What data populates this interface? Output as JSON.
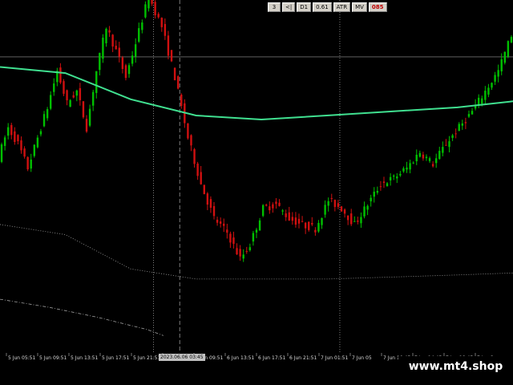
{
  "toolbar": {
    "buttons": [
      {
        "label": "3",
        "style": "normal"
      },
      {
        "label": "<|",
        "style": "normal"
      },
      {
        "label": "D1",
        "style": "normal"
      },
      {
        "label": "0.61",
        "style": "normal"
      },
      {
        "label": "ATR",
        "style": "normal"
      },
      {
        "label": "MV",
        "style": "normal"
      },
      {
        "label": "085",
        "style": "red"
      }
    ]
  },
  "time_axis": {
    "labels": [
      "5 Jun 05:51",
      "5 Jun 09:51",
      "5 Jun 13:51",
      "5 Jun 17:51",
      "5 Jun 21:51",
      "6 Jun 05:51",
      "6 Jun 09:51",
      "6 Jun 13:51",
      "6 Jun 17:51",
      "6 Jun 21:51",
      "7 Jun 01:51",
      "7 Jun 05",
      "7 Jun 10:45",
      "7 Jun 14:45",
      "7 Jun 18:45",
      "7 Jun 2"
    ]
  },
  "cursor_time_label": "2023.06.06 03:45",
  "watermark": "www.mt4.shop",
  "colors": {
    "bull": "#00c000",
    "bear": "#d01010",
    "ma": "#40e090",
    "grid": "#9a9a9a",
    "dotted": "#a0a0a0"
  },
  "chart_data": {
    "type": "candlestick",
    "title": "",
    "xlabel": "",
    "ylabel": "",
    "price_path": [
      [
        0,
        85
      ],
      [
        3,
        100
      ],
      [
        6,
        92
      ],
      [
        9,
        80
      ],
      [
        12,
        95
      ],
      [
        15,
        110
      ],
      [
        18,
        128
      ],
      [
        21,
        112
      ],
      [
        24,
        118
      ],
      [
        27,
        100
      ],
      [
        30,
        128
      ],
      [
        33,
        150
      ],
      [
        36,
        138
      ],
      [
        39,
        125
      ],
      [
        42,
        142
      ],
      [
        46,
        165
      ],
      [
        50,
        150
      ],
      [
        54,
        125
      ],
      [
        58,
        95
      ],
      [
        62,
        72
      ],
      [
        66,
        55
      ],
      [
        70,
        48
      ],
      [
        74,
        35
      ],
      [
        77,
        42
      ],
      [
        81,
        60
      ],
      [
        85,
        62
      ],
      [
        89,
        55
      ],
      [
        93,
        52
      ],
      [
        97,
        50
      ],
      [
        101,
        64
      ],
      [
        105,
        60
      ],
      [
        109,
        52
      ],
      [
        113,
        62
      ],
      [
        117,
        72
      ],
      [
        121,
        75
      ],
      [
        125,
        80
      ],
      [
        129,
        88
      ],
      [
        133,
        82
      ],
      [
        137,
        92
      ],
      [
        141,
        100
      ],
      [
        145,
        108
      ],
      [
        149,
        118
      ],
      [
        153,
        128
      ],
      [
        157,
        146
      ]
    ],
    "moving_average": [
      [
        0,
        130
      ],
      [
        20,
        127
      ],
      [
        40,
        114
      ],
      [
        60,
        106
      ],
      [
        80,
        104
      ],
      [
        100,
        106
      ],
      [
        120,
        108
      ],
      [
        140,
        110
      ],
      [
        157,
        113
      ]
    ],
    "lower_band": [
      [
        0,
        52
      ],
      [
        20,
        47
      ],
      [
        40,
        30
      ],
      [
        60,
        25
      ],
      [
        80,
        25
      ],
      [
        100,
        25
      ],
      [
        120,
        26
      ],
      [
        140,
        27
      ],
      [
        157,
        28
      ]
    ],
    "outer_band": [
      [
        0,
        15
      ],
      [
        15,
        11
      ],
      [
        30,
        6
      ],
      [
        45,
        0
      ],
      [
        50,
        -3
      ]
    ],
    "ylim": [
      -10,
      160
    ],
    "xlim": [
      0,
      157
    ],
    "horizontal_line": 135,
    "vertical_lines": [
      {
        "x": 47,
        "style": "dotted"
      },
      {
        "x": 55,
        "style": "dashed"
      },
      {
        "x": 104,
        "style": "dotted"
      }
    ]
  }
}
